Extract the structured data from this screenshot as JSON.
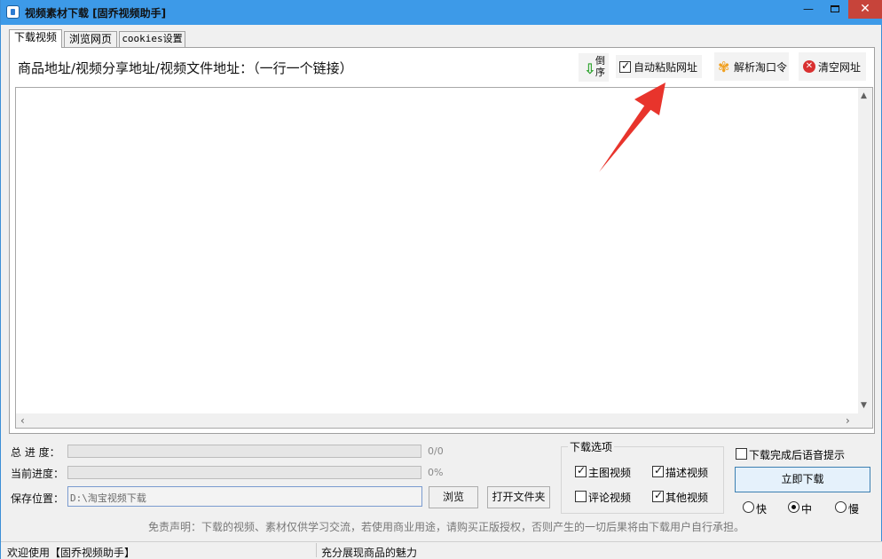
{
  "window": {
    "title": "视频素材下载 [固乔视频助手]",
    "minimize_glyph": "—",
    "close_glyph": "✕"
  },
  "tabs": [
    {
      "label": "下载视频",
      "active": true
    },
    {
      "label": "浏览网页",
      "active": false
    },
    {
      "label": "cookies设置",
      "active": false
    }
  ],
  "toolbar": {
    "url_label": "商品地址/视频分享地址/视频文件地址：（一行一个链接）",
    "reverse_label": "倒序",
    "reverse_icon": "arrow-down-icon",
    "auto_paste_label": "自动粘贴网址",
    "auto_paste_checked": true,
    "parse_label": "解析淘口令",
    "parse_icon": "flower-icon",
    "clear_label": "清空网址",
    "clear_icon": "close-circle-icon"
  },
  "url_input": {
    "value": ""
  },
  "progress": {
    "total_label": "总 进 度：",
    "total_text": "0/0",
    "total_fraction": 0,
    "current_label": "当前进度：",
    "current_text": "0%",
    "current_fraction": 0
  },
  "save": {
    "label": "保存位置：",
    "path": "D:\\淘宝视频下载",
    "browse_label": "浏览",
    "open_folder_label": "打开文件夹"
  },
  "download_options": {
    "title": "下载选项",
    "items": [
      {
        "label": "主图视频",
        "checked": true
      },
      {
        "label": "描述视频",
        "checked": true
      },
      {
        "label": "评论视频",
        "checked": false
      },
      {
        "label": "其他视频",
        "checked": true
      }
    ]
  },
  "voice_prompt": {
    "label": "下载完成后语音提示",
    "checked": false
  },
  "download_now_label": "立即下载",
  "speed": {
    "options": [
      "快",
      "中",
      "慢"
    ],
    "selected": "中"
  },
  "disclaimer": "免责声明：下载的视频、素材仅供学习交流，若使用商业用途，请购买正版授权，否则产生的一切后果将由下载用户自行承担。",
  "statusbar": {
    "left": "欢迎使用【固乔视频助手】",
    "right": "充分展现商品的魅力"
  },
  "colors": {
    "titlebar": "#3d9ae8",
    "close_button": "#c7443a",
    "annotation_arrow": "#e8342c"
  }
}
